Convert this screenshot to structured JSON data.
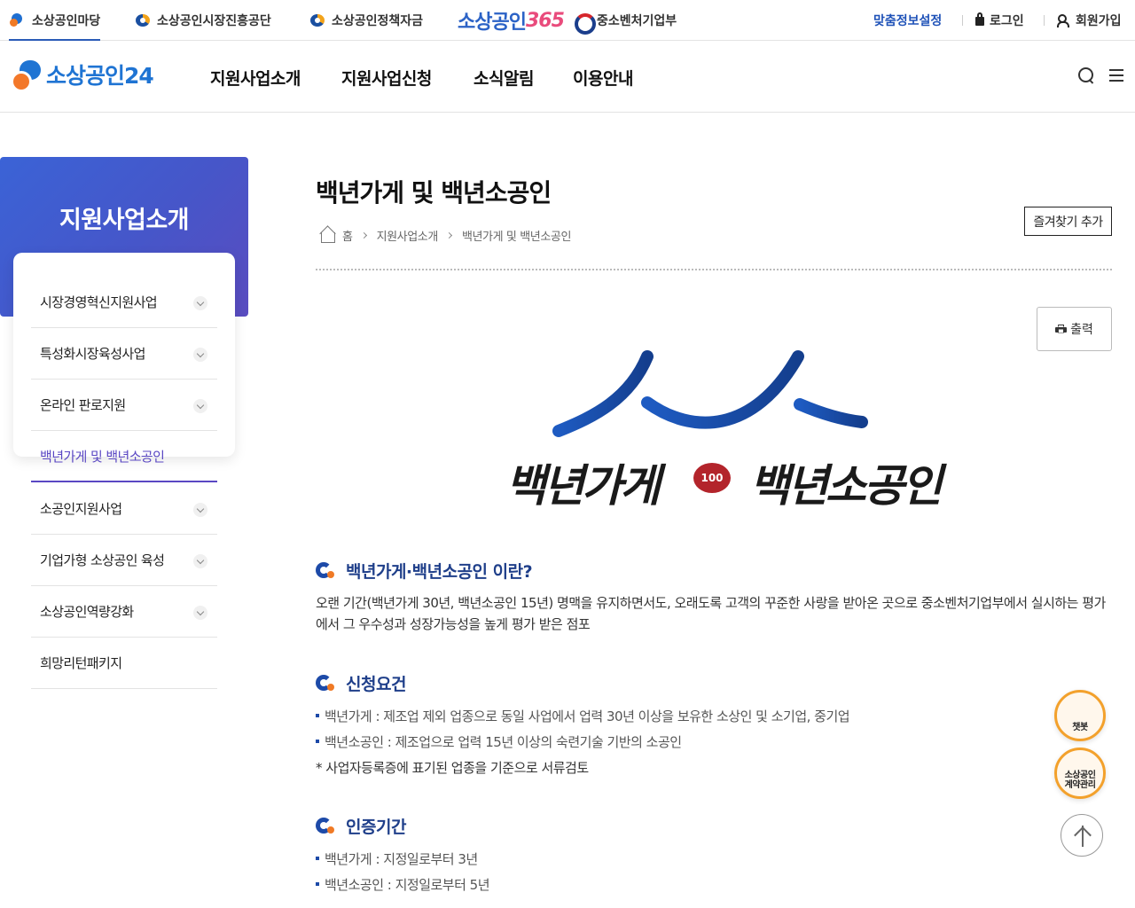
{
  "topbar": {
    "sites": [
      {
        "label": "소상공인마당",
        "icon": "p-logo-icon",
        "active": true
      },
      {
        "label": "소상공인시장진흥공단",
        "icon": "semas-logo-icon"
      },
      {
        "label": "소상공인정책자금",
        "icon": "semas-logo-icon"
      },
      {
        "label_prefix": "소상공인",
        "label_number": "365"
      },
      {
        "label": "중소벤처기업부",
        "icon": "government-emblem-icon"
      }
    ],
    "utility": {
      "custom_info": "맞춤정보설정",
      "login": "로그인",
      "signup": "회원가입"
    }
  },
  "header": {
    "logo_text": "소상공인24",
    "nav": [
      "지원사업소개",
      "지원사업신청",
      "소식알림",
      "이용안내"
    ]
  },
  "sidebar": {
    "title": "지원사업소개",
    "items": [
      {
        "label": "시장경영혁신지원사업",
        "expandable": true
      },
      {
        "label": "특성화시장육성사업",
        "expandable": true
      },
      {
        "label": "온라인 판로지원",
        "expandable": true
      },
      {
        "label": "백년가게 및 백년소공인",
        "expandable": false,
        "active": true
      },
      {
        "label": "소공인지원사업",
        "expandable": true
      },
      {
        "label": "기업가형 소상공인 육성",
        "expandable": true
      },
      {
        "label": "소상공인역량강화",
        "expandable": true
      },
      {
        "label": "희망리턴패키지",
        "expandable": false
      }
    ]
  },
  "content": {
    "title": "백년가게 및 백년소공인",
    "breadcrumb": [
      "홈",
      "지원사업소개",
      "백년가게 및 백년소공인"
    ],
    "favorite_button": "즐겨찾기 추가",
    "print_button": "출력",
    "hero": {
      "left_text": "백년가게",
      "badge_text": "100",
      "right_text": "백년소공인"
    },
    "sections": [
      {
        "heading": "백년가게·백년소공인 이란?",
        "paragraph": "오랜 기간(백년가게 30년, 백년소공인 15년) 명맥을 유지하면서도, 오래도록 고객의 꾸준한 사랑을 받아온 곳으로 중소벤처기업부에서 실시하는 평가에서 그 우수성과 성장가능성을 높게 평가 받은 점포"
      },
      {
        "heading": "신청요건",
        "bullets": [
          "백년가게 : 제조업 제외 업종으로 동일 사업에서 업력 30년 이상을 보유한 소상인 및 소기업, 중기업",
          "백년소공인 : 제조업으로 업력 15년 이상의 숙련기술 기반의 소공인"
        ],
        "note": "* 사업자등록증에 표기된 업종을 기준으로 서류검토"
      },
      {
        "heading": "인증기간",
        "bullets": [
          "백년가게 : 지정일로부터 3년",
          "백년소공인 : 지정일로부터 5년"
        ]
      }
    ]
  },
  "floating": {
    "chatbot_label": "챗봇",
    "contract_label_1": "소상공인",
    "contract_label_2": "계약관리"
  },
  "colors": {
    "brand_blue": "#1f74d3",
    "brand_orange": "#f07a25",
    "sidebar_gradient_start": "#3b63d6",
    "sidebar_gradient_end": "#5a4cc0",
    "active_purple": "#5a47c3",
    "heading_navy": "#1f3f8a",
    "hero_blue": "#1e4fb0",
    "badge_red": "#b3242b"
  }
}
